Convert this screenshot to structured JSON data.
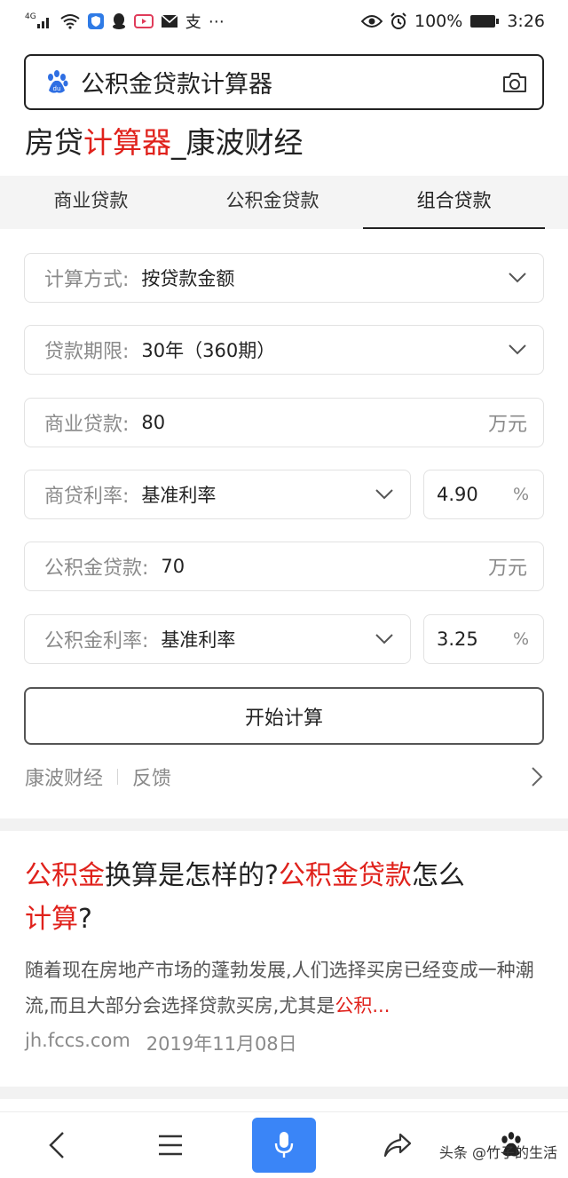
{
  "status_bar": {
    "network": "4G",
    "battery": "100%",
    "time": "3:26",
    "pay_glyph": "支",
    "more": "⋯"
  },
  "search": {
    "query": "公积金贷款计算器",
    "icons": [
      "baidu-paw-icon",
      "camera-icon"
    ]
  },
  "page_title": {
    "prefix": "房贷",
    "highlight": "计算器",
    "suffix": "_康波财经"
  },
  "tabs": [
    {
      "label": "商业贷款",
      "active": false
    },
    {
      "label": "公积金贷款",
      "active": false
    },
    {
      "label": "组合贷款",
      "active": true
    }
  ],
  "form": {
    "calc_method": {
      "label": "计算方式:",
      "value": "按贷款金额"
    },
    "loan_term": {
      "label": "贷款期限:",
      "value": "30年（360期）"
    },
    "commercial_loan": {
      "label": "商业贷款:",
      "value": "80",
      "unit": "万元"
    },
    "commercial_rate": {
      "label": "商贷利率:",
      "value": "基准利率",
      "rate": "4.90",
      "unit": "%"
    },
    "fund_loan": {
      "label": "公积金贷款:",
      "value": "70",
      "unit": "万元"
    },
    "fund_rate": {
      "label": "公积金利率:",
      "value": "基准利率",
      "rate": "3.25",
      "unit": "%"
    },
    "submit": "开始计算"
  },
  "source": {
    "name": "康波财经",
    "feedback": "反馈"
  },
  "result": {
    "title_parts": [
      {
        "text": "公积金",
        "red": true
      },
      {
        "text": "换算是怎样的?",
        "red": false
      },
      {
        "text": "公积金贷款",
        "red": true
      },
      {
        "text": "怎么",
        "red": false
      },
      {
        "text": "计算",
        "red": true
      },
      {
        "text": "?",
        "red": false
      }
    ],
    "desc_plain": "随着现在房地产市场的蓬勃发展,人们选择买房已经变成一种潮流,而且大部分会选择贷款买房,尤其是",
    "desc_highlight": "公积...",
    "domain": "jh.fccs.com",
    "date": "2019年11月08日"
  },
  "bottom_nav": {
    "items": [
      "back-icon",
      "menu-icon",
      "mic-icon",
      "share-icon",
      "baidu-paw-icon"
    ],
    "watermark": "头条 @竹子的生活"
  },
  "colors": {
    "highlight_red": "#e0211b",
    "mic_blue": "#3a85f7",
    "baidu_blue": "#2f6fe3"
  }
}
